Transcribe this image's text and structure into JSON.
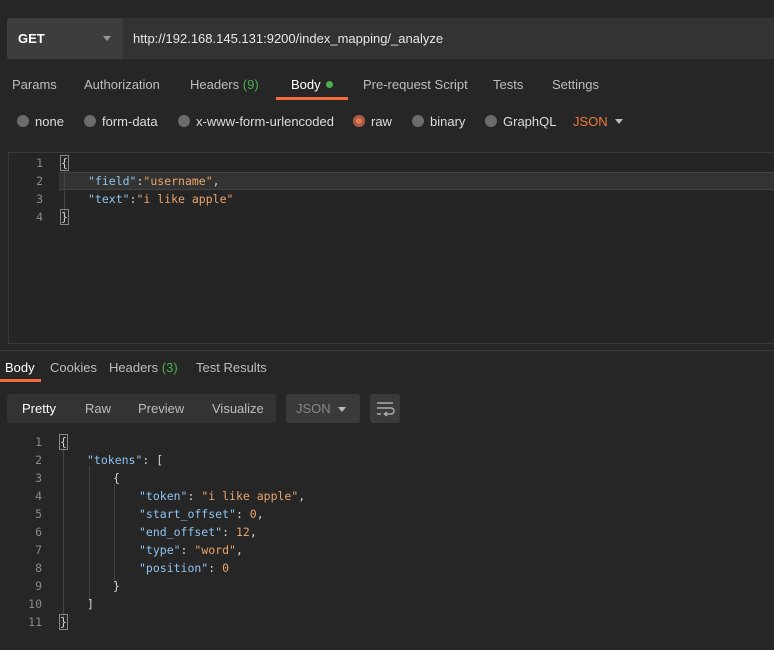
{
  "request": {
    "method": "GET",
    "url": "http://192.168.145.131:9200/index_mapping/_analyze"
  },
  "tabs": [
    {
      "label": "Params"
    },
    {
      "label": "Authorization"
    },
    {
      "label": "Headers",
      "count": "(9)"
    },
    {
      "label": "Body"
    },
    {
      "label": "Pre-request Script"
    },
    {
      "label": "Tests"
    },
    {
      "label": "Settings"
    }
  ],
  "body_types": [
    {
      "label": "none",
      "selected": false
    },
    {
      "label": "form-data",
      "selected": false
    },
    {
      "label": "x-www-form-urlencoded",
      "selected": false
    },
    {
      "label": "raw",
      "selected": true
    },
    {
      "label": "binary",
      "selected": false
    },
    {
      "label": "GraphQL",
      "selected": false
    }
  ],
  "raw_format": "JSON",
  "request_body": {
    "line_numbers": [
      "1",
      "2",
      "3",
      "4"
    ],
    "open": "{",
    "field_key": "\"field\"",
    "field_value": "\"username\"",
    "text_key": "\"text\"",
    "text_value": "\"i like apple\"",
    "close": "}"
  },
  "response_tabs": [
    {
      "label": "Body"
    },
    {
      "label": "Cookies"
    },
    {
      "label": "Headers",
      "count": "(3)"
    },
    {
      "label": "Test Results"
    }
  ],
  "view_modes": [
    "Pretty",
    "Raw",
    "Preview",
    "Visualize"
  ],
  "response_format": "JSON",
  "response_body": {
    "line_numbers": [
      "1",
      "2",
      "3",
      "4",
      "5",
      "6",
      "7",
      "8",
      "9",
      "10",
      "11"
    ],
    "tokens_key": "\"tokens\"",
    "token_key": "\"token\"",
    "token_value": "\"i like apple\"",
    "start_offset_key": "\"start_offset\"",
    "start_offset_value": "0",
    "end_offset_key": "\"end_offset\"",
    "end_offset_value": "12",
    "type_key": "\"type\"",
    "type_value": "\"word\"",
    "position_key": "\"position\"",
    "position_value": "0"
  },
  "colors": {
    "accent": "#f26b3a",
    "count_green": "#4caf50",
    "json_key": "#8fc3f0",
    "json_string": "#e8a46e"
  }
}
